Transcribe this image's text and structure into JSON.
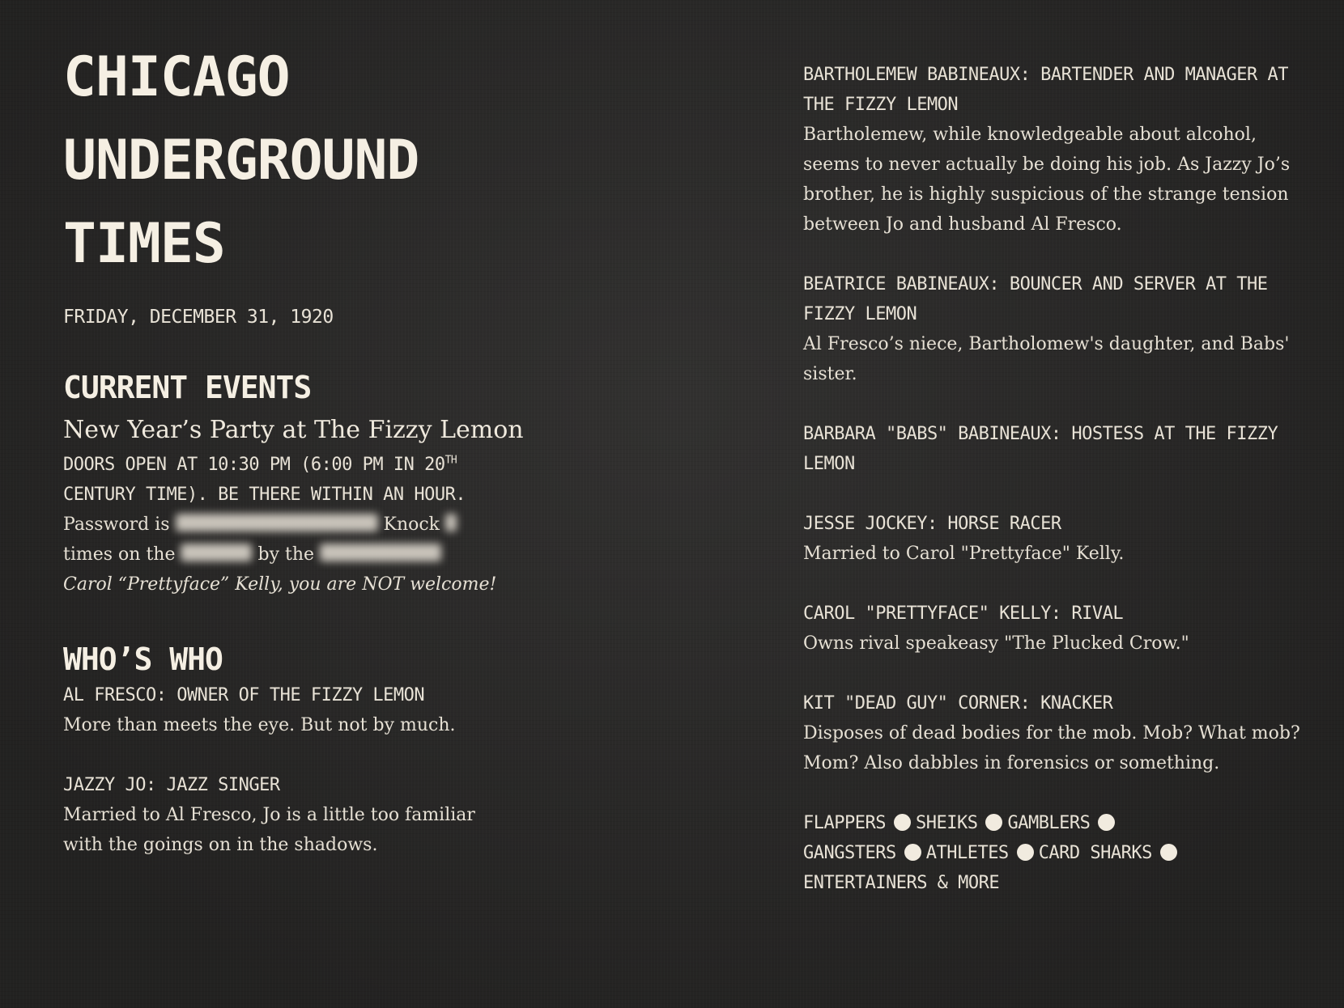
{
  "masthead": {
    "line1": "CHICAGO",
    "line2": "UNDERGROUND",
    "line3": "TIMES",
    "date": "FRIDAY, DECEMBER 31, 1920"
  },
  "current_events": {
    "heading": "CURRENT EVENTS",
    "event_title": "New Year’s Party at The Fizzy Lemon",
    "doors_line1_prefix": "DOORS OPEN AT 10:30 PM (6:00 PM IN 20",
    "doors_sup": "TH",
    "doors_line2": "CENTURY TIME). BE THERE WITHIN AN HOUR.",
    "password_prefix": "Password is",
    "knock_word": "Knock",
    "times_prefix": "times on the",
    "by_the": "by the",
    "warning": "Carol “Prettyface” Kelly, you are NOT welcome!"
  },
  "whos_who": {
    "heading": "WHO’S WHO",
    "left_entries": [
      {
        "role": "AL FRESCO: OWNER OF THE FIZZY LEMON",
        "desc": "More than meets the eye. But not by much."
      },
      {
        "role": "JAZZY JO: JAZZ SINGER",
        "desc": "Married to Al Fresco, Jo is a little too familiar with the goings on in the shadows."
      }
    ],
    "right_entries": [
      {
        "role": "BARTHOLEMEW BABINEAUX: BARTENDER AND MANAGER AT THE FIZZY LEMON",
        "desc": "Bartholemew, while knowledgeable about alcohol, seems to never actually be doing his job. As Jazzy Jo’s brother, he is highly suspicious of the strange tension between Jo and husband Al Fresco."
      },
      {
        "role": "BEATRICE BABINEAUX: BOUNCER AND SERVER AT THE FIZZY LEMON",
        "desc": "Al Fresco’s niece, Bartholomew's daughter, and Babs' sister."
      },
      {
        "role": "BARBARA \"BABS\" BABINEAUX: HOSTESS AT THE FIZZY LEMON",
        "desc": ""
      },
      {
        "role": "JESSE JOCKEY:  HORSE RACER",
        "desc": "Married to Carol \"Prettyface\" Kelly."
      },
      {
        "role": "CAROL \"PRETTYFACE\" KELLY: RIVAL",
        "desc": "Owns rival speakeasy \"The Plucked Crow.\""
      },
      {
        "role": "KIT \"DEAD GUY\" CORNER: KNACKER",
        "desc": "Disposes of dead bodies for the mob. Mob? What mob? Mom? Also dabbles in forensics or something."
      }
    ],
    "roles_list": [
      "FLAPPERS",
      "SHEIKS",
      "GAMBLERS",
      "GANGSTERS",
      "ATHLETES",
      "CARD SHARKS"
    ],
    "roles_tail": "ENTERTAINERS & MORE"
  }
}
